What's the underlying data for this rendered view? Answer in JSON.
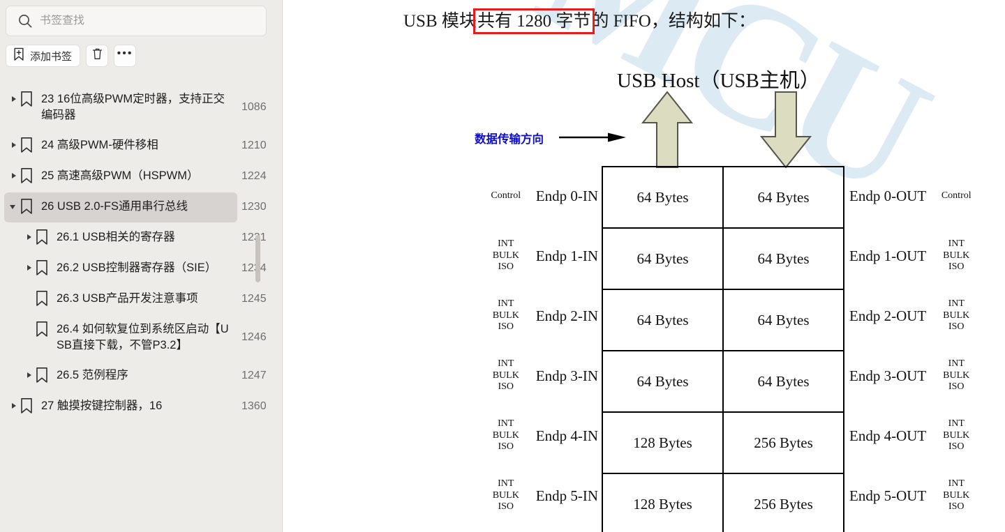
{
  "sidebar": {
    "search": {
      "placeholder": "书签查找",
      "value": "",
      "icon": "search-icon"
    },
    "toolbar": {
      "add_bookmark_label": "添加书签",
      "add_bookmark_icon": "bookmark-add-icon",
      "delete_icon": "trash-icon",
      "more_icon": "more-options-icon"
    },
    "bookmarks": [
      {
        "label": "23  16位高级PWM定时器，支持正交编码器",
        "page": "1086",
        "level": 1,
        "twisty": "collapsed",
        "selected": false
      },
      {
        "label": "24  高级PWM-硬件移相",
        "page": "1210",
        "level": 1,
        "twisty": "collapsed",
        "selected": false
      },
      {
        "label": "25  高速高级PWM（HSPWM）",
        "page": "1224",
        "level": 1,
        "twisty": "collapsed",
        "selected": false
      },
      {
        "label": "26  USB 2.0-FS通用串行总线",
        "page": "1230",
        "level": 1,
        "twisty": "expanded",
        "selected": true
      },
      {
        "label": "26.1  USB相关的寄存器",
        "page": "1231",
        "level": 2,
        "twisty": "collapsed",
        "selected": false
      },
      {
        "label": "26.2  USB控制器寄存器（SIE）",
        "page": "1234",
        "level": 2,
        "twisty": "collapsed",
        "selected": false
      },
      {
        "label": "26.3 USB产品开发注意事项",
        "page": "1245",
        "level": 2,
        "twisty": "none",
        "selected": false
      },
      {
        "label": "26.4  如何软复位到系统区启动【USB直接下载，不管P3.2】",
        "page": "1246",
        "level": 2,
        "twisty": "none",
        "selected": false
      },
      {
        "label": "26.5  范例程序",
        "page": "1247",
        "level": 2,
        "twisty": "collapsed",
        "selected": false
      },
      {
        "label": "27  触摸按键控制器，16",
        "page": "1360",
        "level": 1,
        "twisty": "collapsed",
        "selected": false
      }
    ]
  },
  "document": {
    "watermark": "MCU",
    "heading": {
      "before": "USB 模块",
      "highlight": "共有 1280 字节",
      "after": "的 FIFO，结构如下："
    },
    "host_title": "USB Host（USB主机）",
    "direction_label": "数据传输方向",
    "colors": {
      "highlight_box": "#e81c1c",
      "direction_text": "#1010c8",
      "arrow_fill": "#dcdcc0",
      "arrow_stroke": "#55554a",
      "watermark": "#dbe9f4"
    },
    "fifo": {
      "rows": [
        {
          "type_left": "Control",
          "name_left": "Endp 0-IN",
          "in_size": "64 Bytes",
          "out_size": "64 Bytes",
          "name_right": "Endp 0-OUT",
          "type_right": "Control"
        },
        {
          "type_left": "INT\nBULK\nISO",
          "name_left": "Endp 1-IN",
          "in_size": "64 Bytes",
          "out_size": "64 Bytes",
          "name_right": "Endp 1-OUT",
          "type_right": "INT\nBULK\nISO"
        },
        {
          "type_left": "INT\nBULK\nISO",
          "name_left": "Endp 2-IN",
          "in_size": "64 Bytes",
          "out_size": "64 Bytes",
          "name_right": "Endp 2-OUT",
          "type_right": "INT\nBULK\nISO"
        },
        {
          "type_left": "INT\nBULK\nISO",
          "name_left": "Endp 3-IN",
          "in_size": "64 Bytes",
          "out_size": "64 Bytes",
          "name_right": "Endp 3-OUT",
          "type_right": "INT\nBULK\nISO"
        },
        {
          "type_left": "INT\nBULK\nISO",
          "name_left": "Endp 4-IN",
          "in_size": "128 Bytes",
          "out_size": "256 Bytes",
          "name_right": "Endp 4-OUT",
          "type_right": "INT\nBULK\nISO"
        },
        {
          "type_left": "INT\nBULK\nISO",
          "name_left": "Endp 5-IN",
          "in_size": "128 Bytes",
          "out_size": "256 Bytes",
          "name_right": "Endp 5-OUT",
          "type_right": "INT\nBULK\nISO"
        }
      ]
    }
  }
}
